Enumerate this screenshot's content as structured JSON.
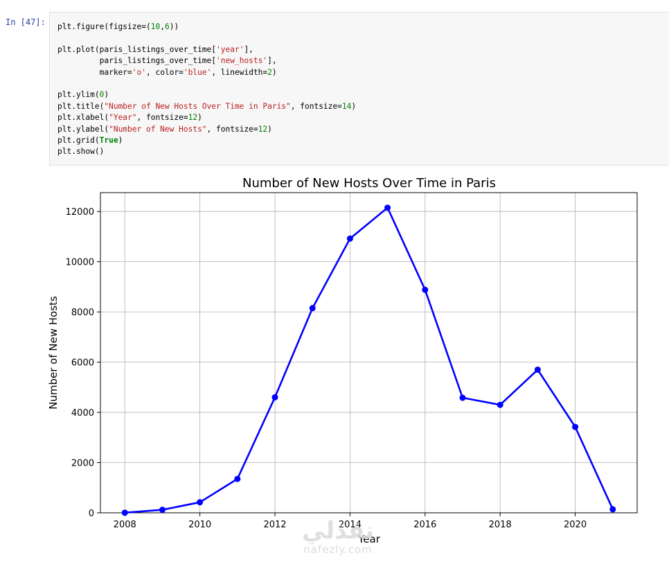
{
  "cell": {
    "prompt": "In [47]:",
    "code": {
      "l1": [
        "plt.figure(figsize=(",
        "10",
        ",",
        "6",
        "))"
      ],
      "l2": [
        "plt.plot(paris_listings_over_time[",
        "'year'",
        "],"
      ],
      "l3": [
        "         paris_listings_over_time[",
        "'new_hosts'",
        "],"
      ],
      "l4": [
        "         marker=",
        "'o'",
        ", color=",
        "'blue'",
        ", linewidth=",
        "2",
        ")"
      ],
      "l5": [
        "plt.ylim(",
        "0",
        ")"
      ],
      "l6": [
        "plt.title(",
        "\"Number of New Hosts Over Time in Paris\"",
        ", fontsize=",
        "14",
        ")"
      ],
      "l7": [
        "plt.xlabel(",
        "\"Year\"",
        ", fontsize=",
        "12",
        ")"
      ],
      "l8": [
        "plt.ylabel(",
        "\"Number of New Hosts\"",
        ", fontsize=",
        "12",
        ")"
      ],
      "l9": [
        "plt.grid(",
        "True",
        ")"
      ],
      "l10": [
        "plt.show()"
      ]
    }
  },
  "chart_data": {
    "type": "line",
    "title": "Number of New Hosts Over Time in Paris",
    "xlabel": "Year",
    "ylabel": "Number of New Hosts",
    "x": [
      2008,
      2009,
      2010,
      2011,
      2012,
      2013,
      2014,
      2015,
      2016,
      2017,
      2018,
      2019,
      2020,
      2021
    ],
    "series": [
      {
        "values": [
          5,
          120,
          420,
          1350,
          4600,
          8150,
          10920,
          12150,
          8880,
          4580,
          4300,
          5700,
          3420,
          140
        ],
        "color": "#0000ff",
        "marker": "o"
      }
    ],
    "xlim": [
      2007.35,
      2021.65
    ],
    "ylim": [
      0,
      12750
    ],
    "xticks": [
      2008,
      2010,
      2012,
      2014,
      2016,
      2018,
      2020
    ],
    "yticks": [
      0,
      2000,
      4000,
      6000,
      8000,
      10000,
      12000
    ],
    "grid": true
  },
  "watermark": {
    "arabic": "نفذلي",
    "latin": "nafezly.com"
  }
}
